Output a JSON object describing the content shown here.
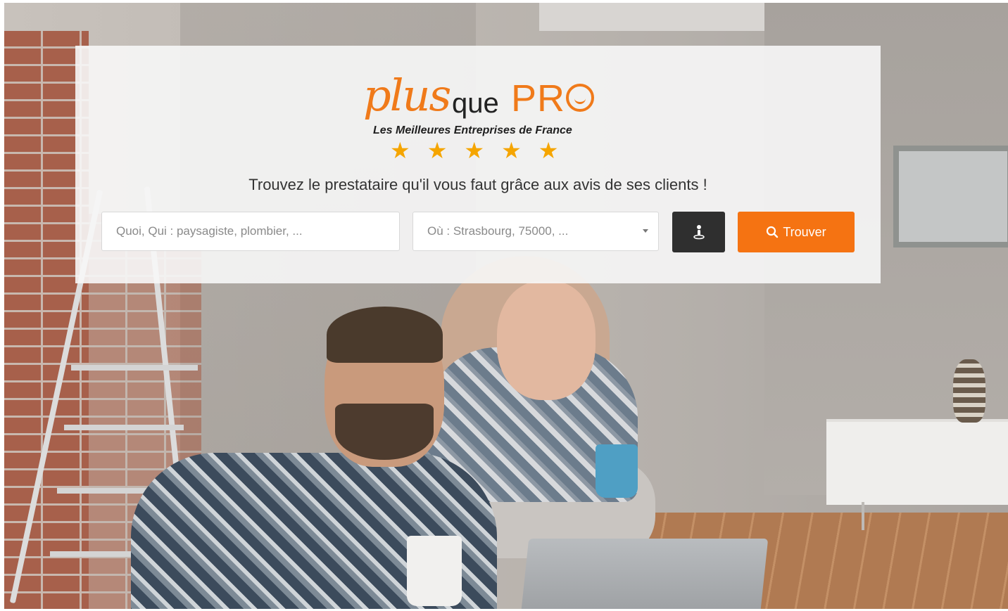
{
  "brand": {
    "logo_plus": "plus",
    "logo_que": "que",
    "logo_pro": "PR",
    "logo_tagline": "Les Meilleures Entreprises de France",
    "rating_stars": 5,
    "accent_color": "#f57312",
    "star_color": "#f5a500"
  },
  "hero": {
    "tagline": "Trouvez le prestataire qu'il vous faut grâce aux avis de ses clients !"
  },
  "search": {
    "what_placeholder": "Quoi, Qui : paysagiste, plombier, ...",
    "where_placeholder": "Où : Strasbourg, 75000, ...",
    "locate_icon": "person-pin-icon",
    "submit_icon": "search-icon",
    "submit_label": "Trouver"
  }
}
